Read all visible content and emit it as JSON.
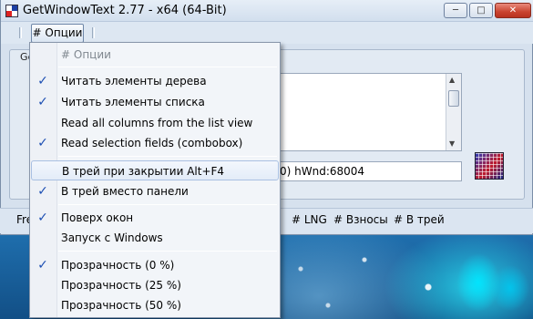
{
  "window": {
    "title": "GetWindowText 2.77 - x64 (64-Bit)",
    "caption_min": "─",
    "caption_max": "□",
    "caption_close": "✕"
  },
  "menubar": {
    "options_label": "# Опции"
  },
  "panel": {
    "label": "Ge"
  },
  "hwnd_field": {
    "value": "0) hWnd:68004"
  },
  "bottom_bar": {
    "left_text": "Fre",
    "lng": "# LNG",
    "vznosy": "# Взносы",
    "tray": "# В трей"
  },
  "dropdown": {
    "header": "# Опции",
    "items": [
      {
        "label": "Читать элементы дерева",
        "checked": true
      },
      {
        "label": "Читать элементы списка",
        "checked": true
      },
      {
        "label": "Read all columns from the list view",
        "checked": false
      },
      {
        "label": "Read selection fields (combobox)",
        "checked": true
      },
      {
        "label": "В трей при закрытии Alt+F4",
        "checked": false,
        "highlighted": true
      },
      {
        "label": "В трей вместо панели",
        "checked": true
      },
      {
        "label": "Поверх окон",
        "checked": true
      },
      {
        "label": "Запуск с Windows",
        "checked": false
      },
      {
        "label": "Прозрачность (0 %)",
        "checked": true
      },
      {
        "label": "Прозрачность (25 %)",
        "checked": false
      },
      {
        "label": "Прозрачность (50 %)",
        "checked": false
      }
    ],
    "check_glyph": "✓"
  },
  "icons": {
    "app": "app-icon",
    "finder": "crosshair-finder-icon"
  }
}
